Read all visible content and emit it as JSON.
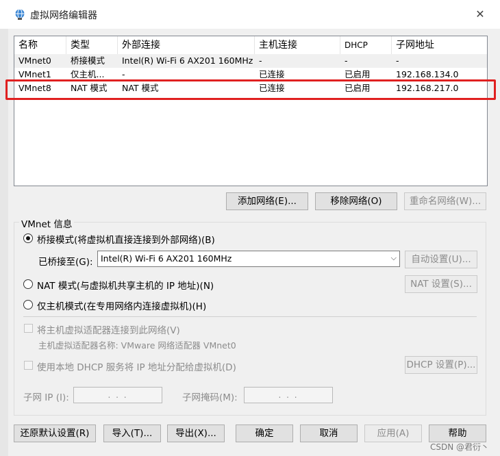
{
  "window": {
    "title": "虚拟网络编辑器",
    "close": "✕"
  },
  "table": {
    "headers": [
      "名称",
      "类型",
      "外部连接",
      "主机连接",
      "DHCP",
      "子网地址"
    ],
    "rows": [
      [
        "VMnet0",
        "桥接模式",
        "Intel(R) Wi-Fi 6 AX201 160MHz",
        "-",
        "-",
        "-"
      ],
      [
        "VMnet1",
        "仅主机...",
        "-",
        "已连接",
        "已启用",
        "192.168.134.0"
      ],
      [
        "VMnet8",
        "NAT 模式",
        "NAT 模式",
        "已连接",
        "已启用",
        "192.168.217.0"
      ]
    ],
    "highlight_color": "#e02020"
  },
  "net_buttons": {
    "add": "添加网络(E)...",
    "remove": "移除网络(O)",
    "rename": "重命名网络(W)..."
  },
  "info": {
    "group_title": "VMnet 信息",
    "bridged_label": "桥接模式(将虚拟机直接连接到外部网络)(B)",
    "bridged_to_label": "已桥接至(G):",
    "bridged_to_value": "Intel(R) Wi-Fi 6 AX201 160MHz",
    "auto_settings": "自动设置(U)...",
    "nat_label": "NAT 模式(与虚拟机共享主机的 IP 地址)(N)",
    "nat_settings": "NAT 设置(S)...",
    "hostonly_label": "仅主机模式(在专用网络内连接虚拟机)(H)",
    "connect_adapter_label": "将主机虚拟适配器连接到此网络(V)",
    "adapter_name_label": "主机虚拟适配器名称: VMware 网络适配器 VMnet0",
    "dhcp_label": "使用本地 DHCP 服务将 IP 地址分配给虚拟机(D)",
    "dhcp_settings": "DHCP 设置(P)...",
    "subnet_ip_label": "子网 IP (I):",
    "subnet_ip_value": ". . .",
    "subnet_mask_label": "子网掩码(M):",
    "subnet_mask_value": ". . ."
  },
  "footer": {
    "restore": "还原默认设置(R)",
    "import": "导入(T)...",
    "export": "导出(X)...",
    "ok": "确定",
    "cancel": "取消",
    "apply": "应用(A)",
    "help": "帮助"
  },
  "watermark": "CSDN @君衍丶"
}
